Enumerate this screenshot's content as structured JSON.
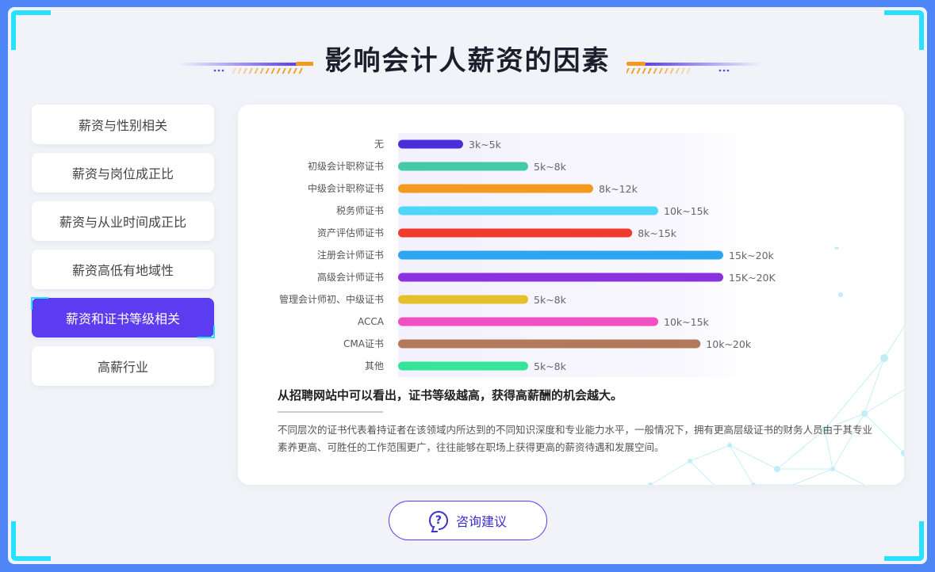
{
  "page": {
    "title": "影响会计人薪资的因素"
  },
  "tabs": [
    {
      "label": "薪资与性别相关",
      "active": false
    },
    {
      "label": "薪资与岗位成正比",
      "active": false
    },
    {
      "label": "薪资与从业时间成正比",
      "active": false
    },
    {
      "label": "薪资高低有地域性",
      "active": false
    },
    {
      "label": "薪资和证书等级相关",
      "active": true
    },
    {
      "label": "高薪行业",
      "active": false
    }
  ],
  "chart_data": {
    "type": "bar",
    "orientation": "horizontal",
    "categories": [
      "无",
      "初级会计职称证书",
      "中级会计职称证书",
      "税务师证书",
      "资产评估师证书",
      "注册会计师证书",
      "高级会计师证书",
      "管理会计师初、中级证书",
      "ACCA",
      "CMA证书",
      "其他"
    ],
    "value_labels": [
      "3k~5k",
      "5k~8k",
      "8k~12k",
      "10k~15k",
      "8k~15k",
      "15k~20k",
      "15K~20K",
      "5k~8k",
      "10k~15k",
      "10k~20k",
      "5k~8k"
    ],
    "values": [
      2,
      4,
      6,
      8,
      7.2,
      10,
      10,
      4,
      8,
      9.3,
      4
    ],
    "xlim": [
      0,
      10
    ],
    "colors": [
      "#4a2fd9",
      "#45c9a7",
      "#f59a1f",
      "#4fd6f8",
      "#f03a2c",
      "#2ea5f0",
      "#8a32e0",
      "#e4c02a",
      "#f24fc2",
      "#b07a5b",
      "#35e59a"
    ]
  },
  "summary": "从招聘网站中可以看出，证书等级越高，获得高薪酬的机会越大。",
  "description": "不同层次的证书代表着持证者在该领域内所达到的不同知识深度和专业能力水平，一般情况下，拥有更高层级证书的财务人员由于其专业素养更高、可胜任的工作范围更广，往往能够在职场上获得更高的薪资待遇和发展空间。",
  "consult_button": {
    "label": "咨询建议",
    "icon": "question-chat-icon"
  },
  "colors": {
    "accent": "#5b3cf0",
    "frame": "#4f86f7",
    "corner": "#27e1ff"
  }
}
